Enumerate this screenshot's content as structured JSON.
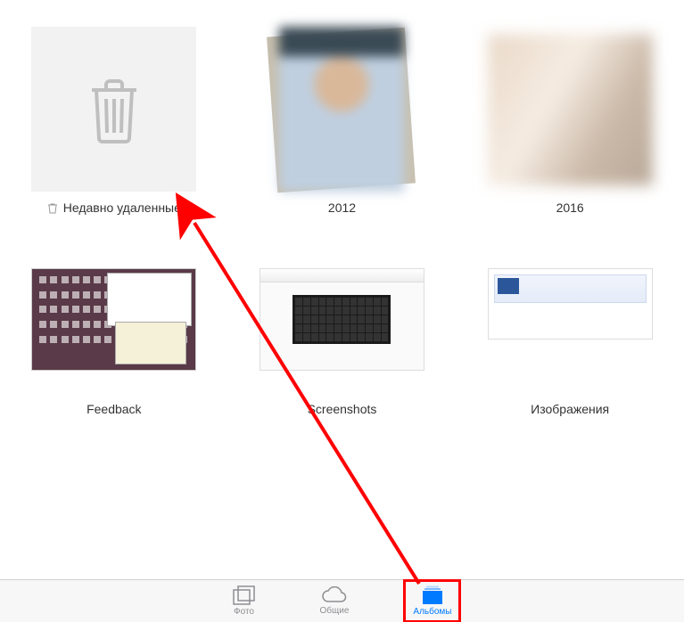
{
  "albums": [
    {
      "id": "recently-deleted",
      "label": "Недавно удаленные"
    },
    {
      "id": "2012",
      "label": "2012"
    },
    {
      "id": "2016",
      "label": "2016"
    },
    {
      "id": "feedback",
      "label": "Feedback"
    },
    {
      "id": "screenshots",
      "label": "Screenshots"
    },
    {
      "id": "images",
      "label": "Изображения"
    }
  ],
  "tabs": {
    "photos": "Фото",
    "shared": "Общие",
    "albums": "Альбомы"
  },
  "colors": {
    "accent": "#007aff",
    "annotation": "#ff0000",
    "inactive": "#8e8e93"
  }
}
